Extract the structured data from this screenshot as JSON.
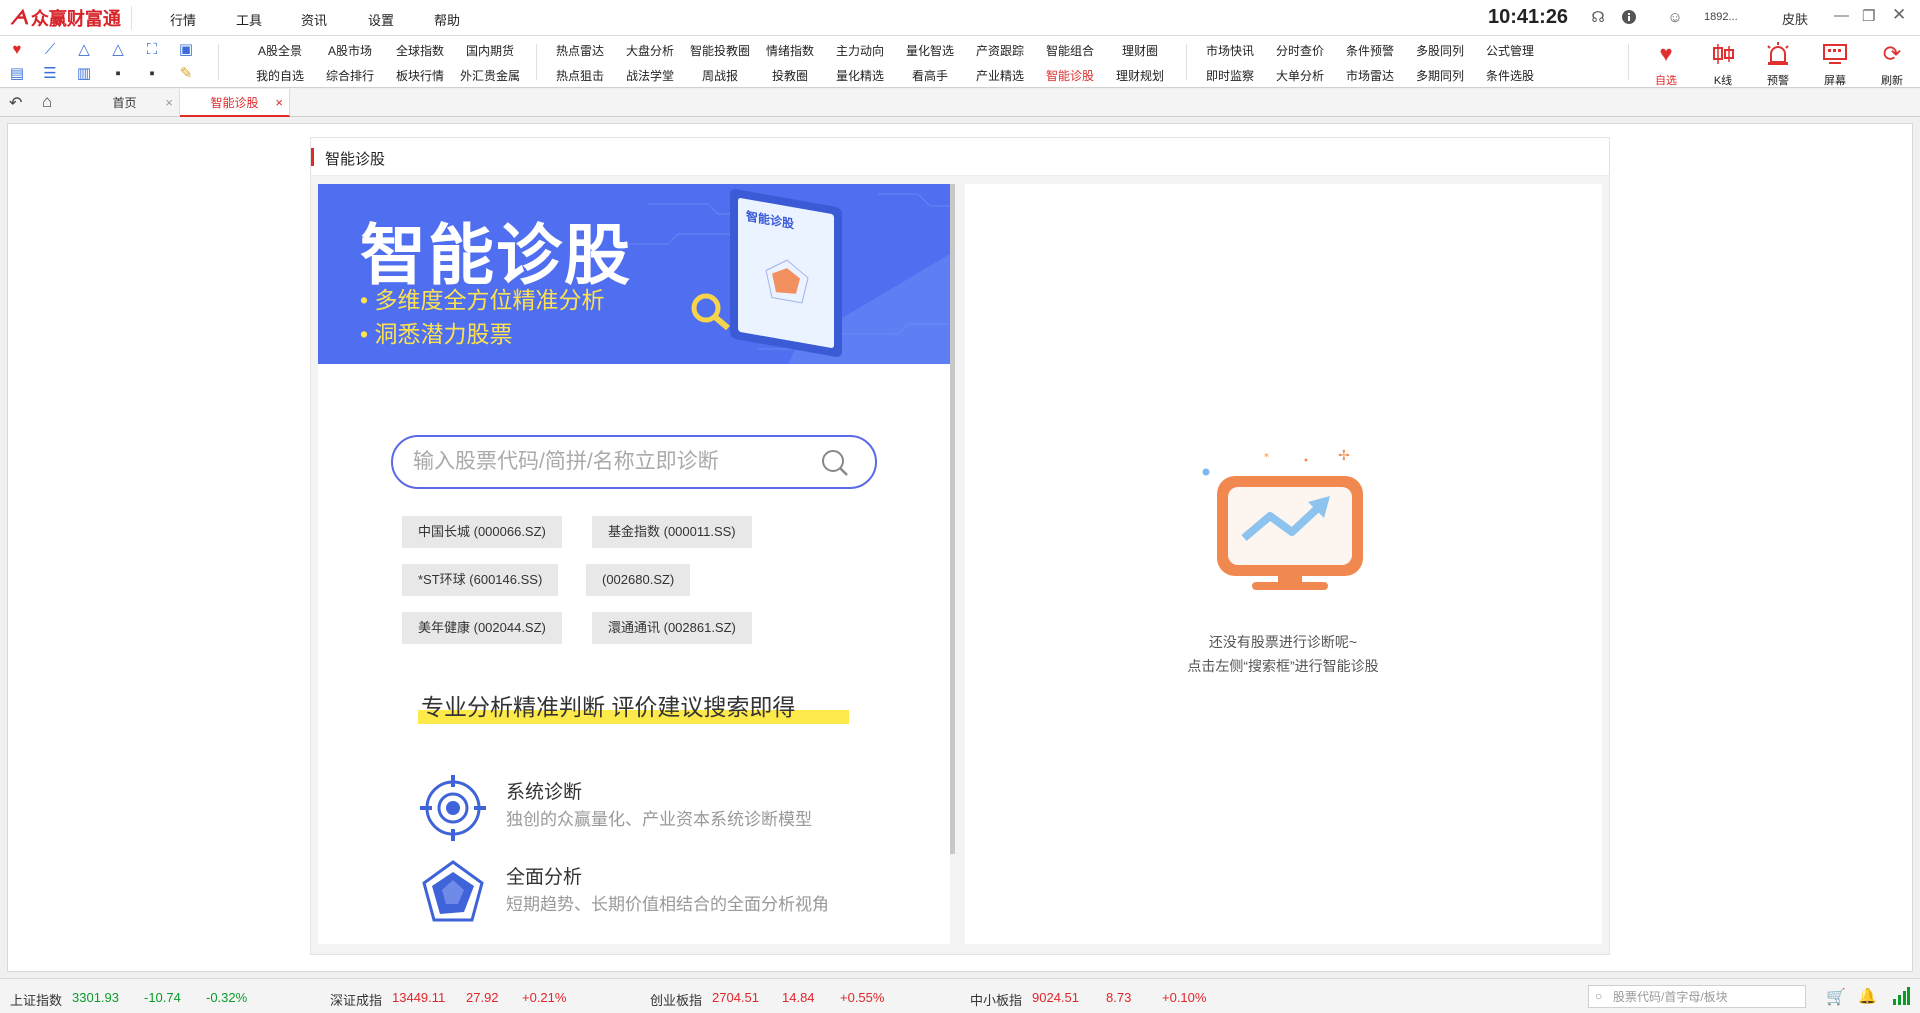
{
  "app": {
    "logo_text": "众赢财富通",
    "clock": "10:41:26",
    "user": "1892...",
    "skin": "皮肤"
  },
  "menu": [
    "行情",
    "工具",
    "资讯",
    "设置",
    "帮助"
  ],
  "toolbar": {
    "row1": [
      "A股全景",
      "A股市场",
      "全球指数",
      "国内期货",
      "热点雷达",
      "大盘分析",
      "智能投教圈",
      "情绪指数",
      "主力动向",
      "量化智选",
      "产资跟踪",
      "智能组合",
      "理财圈",
      "市场快讯",
      "分时查价",
      "条件预警",
      "多股同列",
      "公式管理"
    ],
    "row2": [
      "我的自选",
      "综合排行",
      "板块行情",
      "外汇贵金属",
      "热点狙击",
      "战法学堂",
      "周战报",
      "投教圈",
      "量化精选",
      "看高手",
      "产业精选",
      "智能诊股",
      "理财规划",
      "即时监察",
      "大单分析",
      "市场雷达",
      "多期同列",
      "条件选股"
    ],
    "right_buttons": [
      "自选",
      "K线",
      "预警",
      "屏幕",
      "刷新"
    ],
    "active": "智能诊股"
  },
  "tabs": [
    {
      "label": "首页"
    },
    {
      "label": "智能诊股"
    }
  ],
  "panel": {
    "title": "智能诊股",
    "banner": {
      "title": "智能诊股",
      "bullet1": "多维度全方位精准分析",
      "bullet2": "洞悉潜力股票",
      "screen_title": "智能诊股"
    },
    "search_placeholder": "输入股票代码/简拼/名称立即诊断",
    "chips": [
      "中国长城 (000066.SZ)",
      "基金指数 (000011.SS)",
      "*ST环球 (600146.SS)",
      "(002680.SZ)",
      "美年健康 (002044.SZ)",
      "澴通通讯 (002861.SZ)"
    ],
    "slogan": "专业分析精准判断 评价建议搜索即得",
    "features": [
      {
        "title": "系统诊断",
        "desc": "独创的众赢量化、产业资本系统诊断模型"
      },
      {
        "title": "全面分析",
        "desc": "短期趋势、长期价值相结合的全面分析视角"
      }
    ],
    "empty_line1": "还没有股票进行诊断呢~",
    "empty_line2": "点击左侧“搜索框”进行智能诊股"
  },
  "status": {
    "indices": [
      {
        "name": "上证指数",
        "value": "3301.93",
        "change": "-10.74",
        "pct": "-0.32%"
      },
      {
        "name": "深证成指",
        "value": "13449.11",
        "change": "27.92",
        "pct": "+0.21%"
      },
      {
        "name": "创业板指",
        "value": "2704.51",
        "change": "14.84",
        "pct": "+0.55%"
      },
      {
        "name": "中小板指",
        "value": "9024.51",
        "change": "8.73",
        "pct": "+0.10%"
      }
    ],
    "search_placeholder": "股票代码/首字母/板块"
  },
  "colors": {
    "brand_red": "#e02a2a",
    "banner_blue": "#4f6ff0",
    "accent_yellow": "#fde94a",
    "up_red": "#e0262b",
    "down_green": "#0a9b2c"
  }
}
